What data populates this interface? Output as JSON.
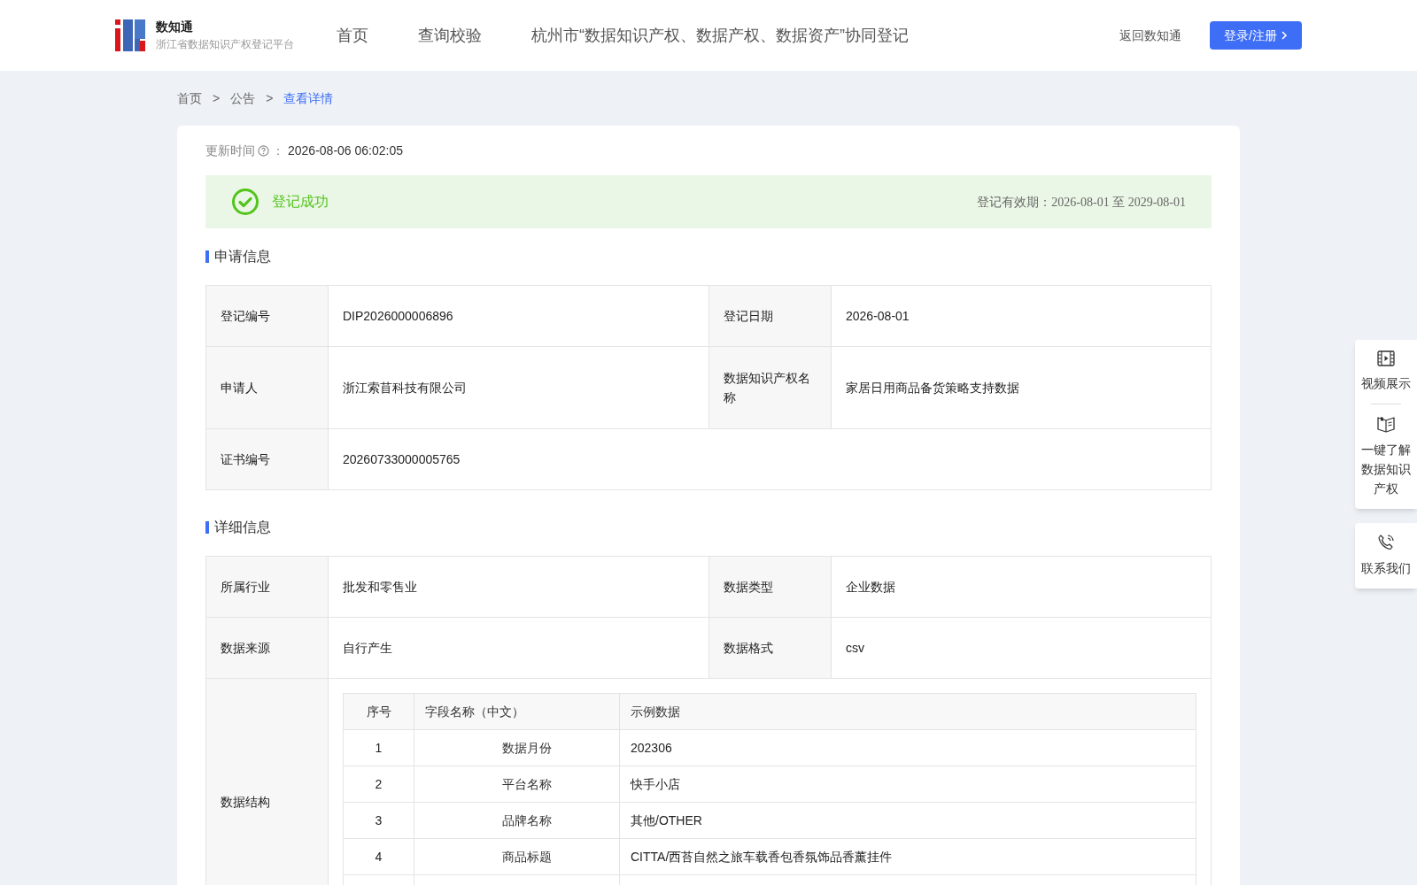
{
  "header": {
    "logo_title": "数知通",
    "logo_subtitle": "浙江省数据知识产权登记平台",
    "nav": [
      {
        "label": "首页",
        "selected": false
      },
      {
        "label": "查询校验",
        "selected": false
      },
      {
        "label": "杭州市“数据知识产权、数据产权、数据资产”协同登记",
        "selected": false
      }
    ],
    "back_link": "返回数知通",
    "login_button": "登录/注册"
  },
  "breadcrumb": [
    {
      "label": "首页",
      "selected": false
    },
    {
      "label": "公告",
      "selected": false
    },
    {
      "label": "查看详情",
      "selected": true
    }
  ],
  "breadcrumb_separator": ">",
  "update": {
    "label": "更新时间",
    "colon": "：",
    "value": "2026-08-06 06:02:05"
  },
  "status": {
    "text": "登记成功",
    "validity": "登记有效期：2026-08-01 至 2029-08-01"
  },
  "sections": [
    {
      "title": "申请信息",
      "rows": [
        [
          {
            "label": "登记编号",
            "value": "DIP2026000006896"
          },
          {
            "label": "登记日期",
            "value": "2026-08-01"
          }
        ],
        [
          {
            "label": "申请人",
            "value": "浙江索苜科技有限公司"
          },
          {
            "label": "数据知识产权名称",
            "value": "家居日用商品备货策略支持数据"
          }
        ],
        [
          {
            "label": "证书编号",
            "value": "20260733000005765"
          }
        ]
      ]
    },
    {
      "title": "详细信息",
      "rows": [
        [
          {
            "label": "所属行业",
            "value": "批发和零售业"
          },
          {
            "label": "数据类型",
            "value": "企业数据"
          }
        ],
        [
          {
            "label": "数据来源",
            "value": "自行产生"
          },
          {
            "label": "数据格式",
            "value": "csv"
          }
        ]
      ],
      "structure": {
        "label": "数据结构",
        "columns": [
          "序号",
          "字段名称（中文）",
          "示例数据"
        ],
        "rows": [
          [
            "1",
            "数据月份",
            "202306"
          ],
          [
            "2",
            "平台名称",
            "快手小店"
          ],
          [
            "3",
            "品牌名称",
            "其他/OTHER"
          ],
          [
            "4",
            "商品标题",
            "CITTA/西苔自然之旅车载香包香氛饰品香薰挂件"
          ]
        ]
      }
    }
  ],
  "side_panels": [
    {
      "items": [
        {
          "kind": "video",
          "label": "视频展示"
        },
        {
          "kind": "book",
          "label": "一键了解数据知识产权"
        }
      ]
    },
    {
      "items": [
        {
          "kind": "phone",
          "label": "联系我们"
        }
      ]
    }
  ]
}
